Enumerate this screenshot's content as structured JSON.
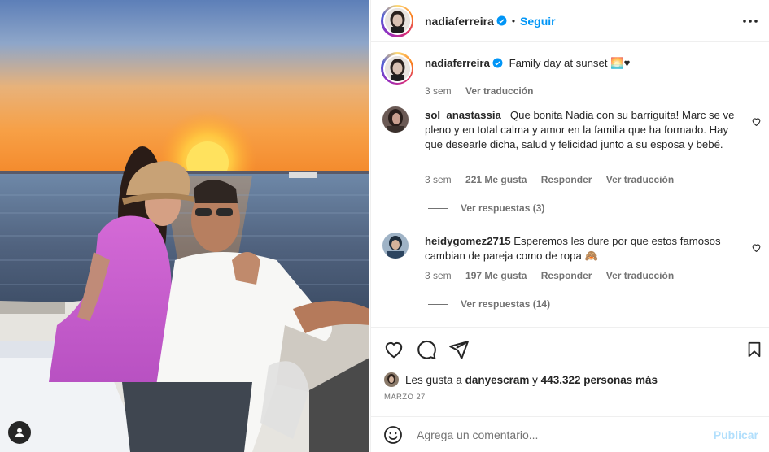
{
  "post": {
    "photo_alt": "Couple on a boat at sunset",
    "header": {
      "username": "nadiaferreira",
      "separator": "•",
      "follow_label": "Seguir"
    },
    "caption": {
      "username": "nadiaferreira",
      "text": "Family day at sunset 🌅♥",
      "time": "3 sem",
      "translate_label": "Ver traducción"
    },
    "comments": [
      {
        "username": "sol_anastassia_",
        "text": "Que bonita Nadia con su barriguita! Marc se ve pleno y en total calma y amor en la familia que ha formado. Hay que desearle dicha, salud y felicidad junto a su esposa y bebé.",
        "time": "3 sem",
        "likes": "221 Me gusta",
        "reply_label": "Responder",
        "translate_label": "Ver traducción",
        "view_replies": "Ver respuestas (3)"
      },
      {
        "username": "heidygomez2715",
        "text": "Esperemos les dure por que estos famosos cambian de pareja como de ropa 🙈",
        "time": "3 sem",
        "likes": "197 Me gusta",
        "reply_label": "Responder",
        "translate_label": "Ver traducción",
        "view_replies": "Ver respuestas (14)"
      }
    ],
    "likes": {
      "prefix": "Les gusta a",
      "user": "danyescram",
      "connector": "y",
      "count": "443.322 personas más"
    },
    "date": "MARZO 27",
    "add_comment": {
      "placeholder": "Agrega un comentario...",
      "post_label": "Publicar"
    }
  },
  "colors": {
    "accent": "#0095f6",
    "post_disabled": "#b2dffc",
    "muted": "#737373",
    "text": "#262626"
  }
}
